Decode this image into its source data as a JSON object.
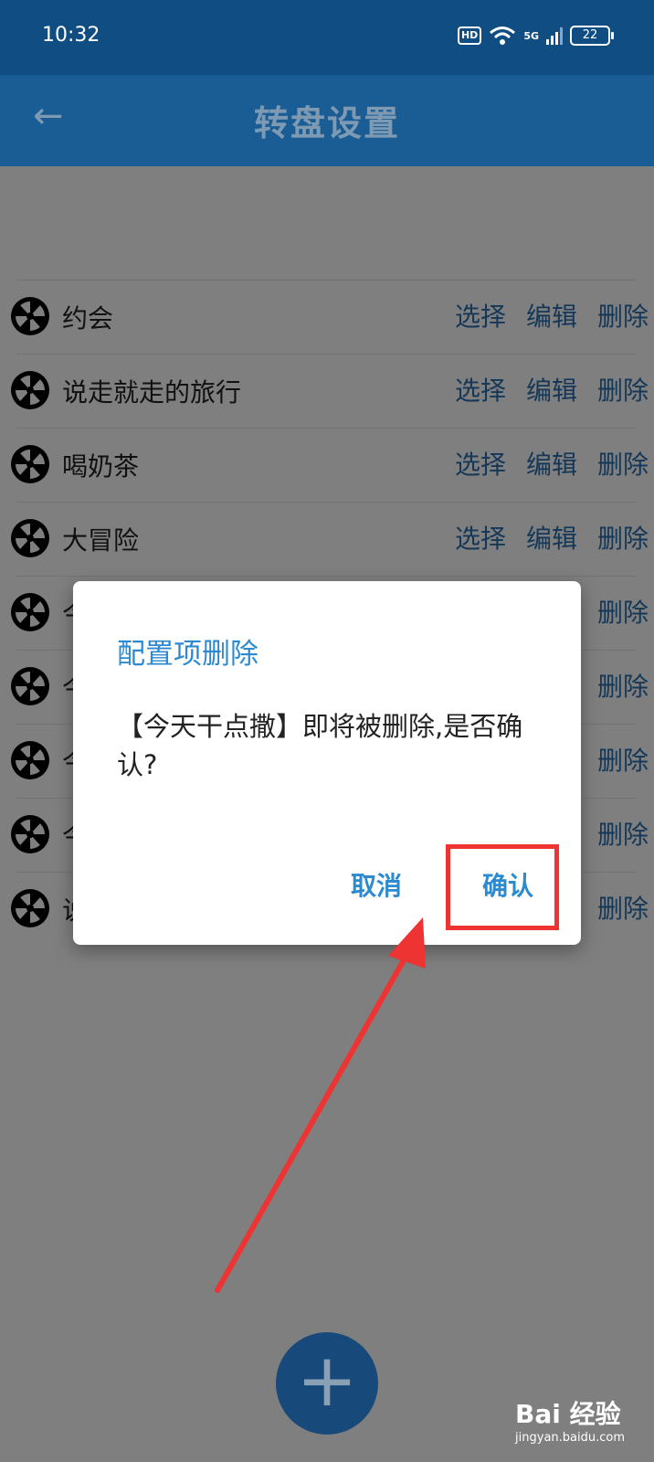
{
  "status": {
    "time": "10:32",
    "hd": "HD",
    "network": "5G",
    "battery": "22"
  },
  "header": {
    "title": "转盘设置",
    "back_icon": "←"
  },
  "list": {
    "items": [
      {
        "label": "约会"
      },
      {
        "label": "说走就走的旅行"
      },
      {
        "label": "喝奶茶"
      },
      {
        "label": "大冒险"
      },
      {
        "label": "今"
      },
      {
        "label": "今"
      },
      {
        "label": "今"
      },
      {
        "label": "今"
      },
      {
        "label": "说"
      }
    ],
    "actions": {
      "select": "选择",
      "edit": "编辑",
      "delete": "删除"
    }
  },
  "dialog": {
    "title": "配置项删除",
    "message": "【今天干点撒】即将被删除,是否确认?",
    "cancel": "取消",
    "confirm": "确认"
  },
  "fab": {
    "icon": "+"
  },
  "watermark": {
    "brand": "Bai 经验",
    "url": "jingyan.baidu.com"
  },
  "colors": {
    "primary": "#1a5c94",
    "accent": "#2c8ad1",
    "highlight": "#ee3333"
  }
}
